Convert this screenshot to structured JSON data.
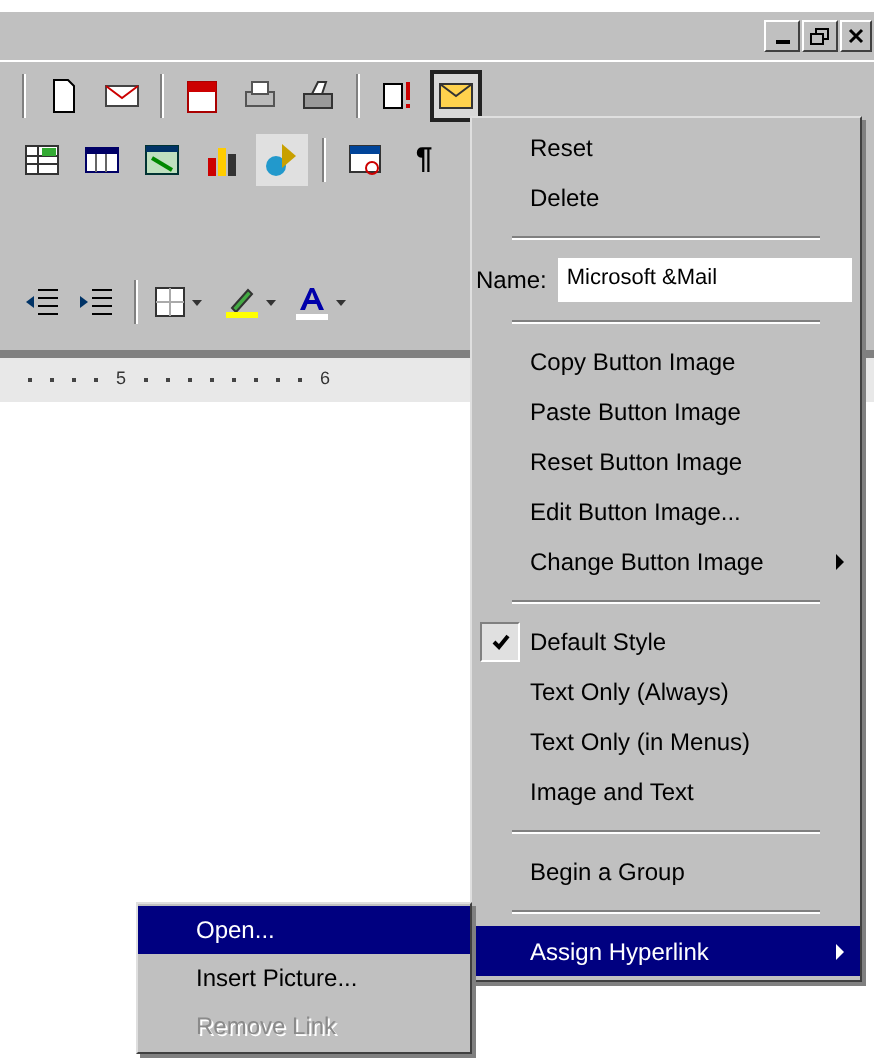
{
  "toolbar_standard": [
    {
      "kind": "new",
      "selected": false
    },
    {
      "kind": "mail",
      "selected": false
    },
    {
      "kind": "calendar",
      "selected": false
    },
    {
      "kind": "preview",
      "selected": false
    },
    {
      "kind": "print",
      "selected": false
    },
    {
      "kind": "alert",
      "selected": false
    },
    {
      "kind": "mailbutton",
      "selected": true
    }
  ],
  "toolbar_tables": [
    {
      "kind": "table"
    },
    {
      "kind": "sheet"
    },
    {
      "kind": "excel"
    },
    {
      "kind": "chart"
    },
    {
      "kind": "drawing"
    },
    {
      "kind": "map"
    },
    {
      "kind": "text",
      "label": "¶"
    }
  ],
  "ruler": {
    "labels": [
      "5",
      "6"
    ]
  },
  "context_menu": [
    {
      "kind": "item",
      "label": "Reset",
      "selected": false
    },
    {
      "kind": "item",
      "label": "Delete",
      "selected": false
    },
    {
      "kind": "separator"
    },
    {
      "kind": "field",
      "label": "Name:",
      "value": "Microsoft &Mail"
    },
    {
      "kind": "separator"
    },
    {
      "kind": "item",
      "label": "Copy Button Image",
      "selected": false
    },
    {
      "kind": "item",
      "label": "Paste Button Image",
      "selected": false
    },
    {
      "kind": "item",
      "label": "Reset Button Image",
      "selected": false
    },
    {
      "kind": "item",
      "label": "Edit Button Image...",
      "selected": false
    },
    {
      "kind": "submenu",
      "label": "Change Button Image",
      "selected": false
    },
    {
      "kind": "separator"
    },
    {
      "kind": "check",
      "label": "Default Style",
      "checked": true
    },
    {
      "kind": "check",
      "label": "Text Only (Always)",
      "checked": false
    },
    {
      "kind": "check",
      "label": "Text Only (in Menus)",
      "checked": false
    },
    {
      "kind": "check",
      "label": "Image and Text",
      "checked": false
    },
    {
      "kind": "separator"
    },
    {
      "kind": "item",
      "label": "Begin a Group",
      "selected": false
    },
    {
      "kind": "separator"
    },
    {
      "kind": "submenu",
      "label": "Assign Hyperlink",
      "selected": true
    }
  ],
  "submenu": [
    {
      "label": "Open...",
      "selected": true,
      "disabled": false
    },
    {
      "label": "Insert Picture...",
      "selected": false,
      "disabled": false
    },
    {
      "label": "Remove Link",
      "selected": false,
      "disabled": true
    }
  ]
}
